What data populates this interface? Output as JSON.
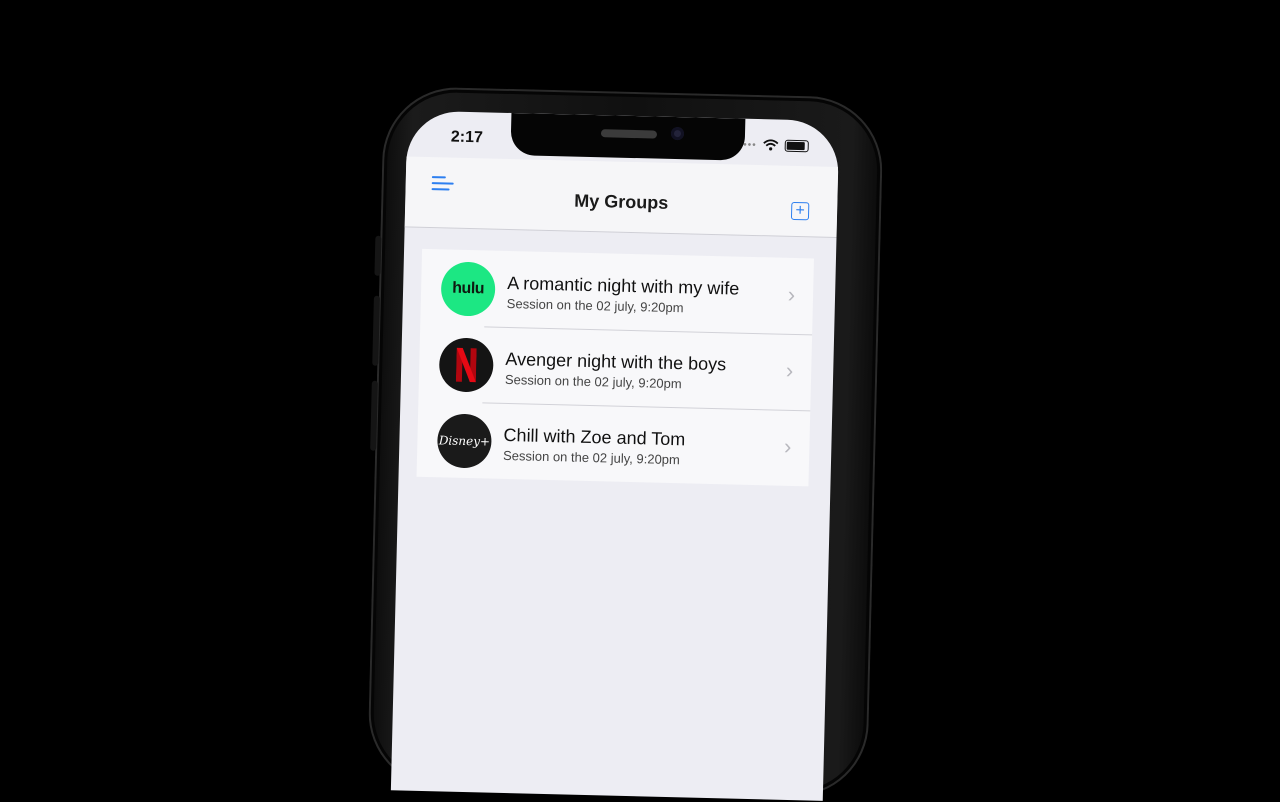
{
  "status_bar": {
    "time": "2:17"
  },
  "header": {
    "title": "My Groups"
  },
  "groups": [
    {
      "service": "hulu",
      "logo_text": "hulu",
      "title": "A romantic night with my wife",
      "subtitle": "Session on the 02 july, 9:20pm"
    },
    {
      "service": "netflix",
      "logo_text": "N",
      "title": "Avenger night with the boys",
      "subtitle": "Session on the 02 july, 9:20pm"
    },
    {
      "service": "disney",
      "logo_text": "Disney+",
      "title": "Chill with Zoe and Tom",
      "subtitle": "Session on the 02 july, 9:20pm"
    }
  ],
  "colors": {
    "accent": "#2d7ff0",
    "hulu": "#1ce783",
    "netflix_red": "#e50914"
  },
  "icons": {
    "menu": "menu-icon",
    "add": "add-square-icon",
    "chevron": "chevron-right-icon",
    "wifi": "wifi-icon",
    "battery": "battery-icon"
  }
}
